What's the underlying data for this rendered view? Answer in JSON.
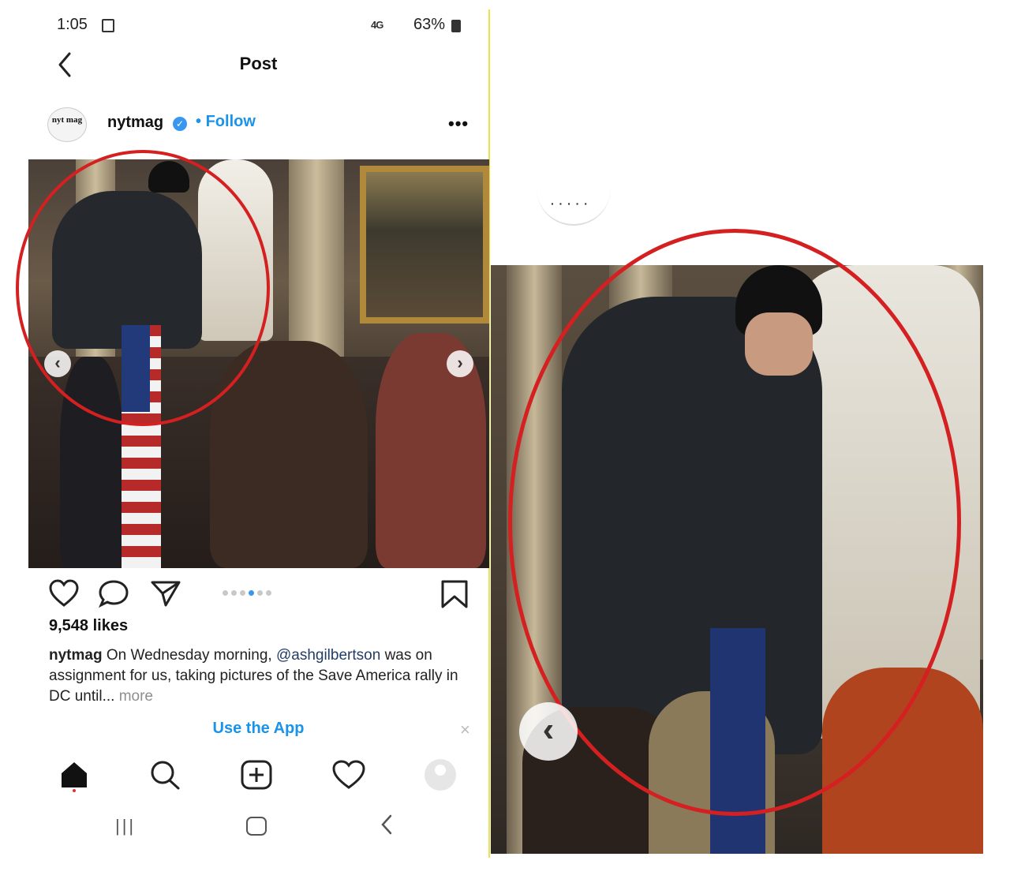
{
  "status_bar": {
    "time": "1:05",
    "network": "4G",
    "battery": "63%"
  },
  "header": {
    "title": "Post"
  },
  "post": {
    "username": "nytmag",
    "avatar_text": "nyt mag",
    "follow_label": "Follow",
    "follow_separator": "•",
    "more_label": "•••",
    "likes": "9,548 likes",
    "caption": {
      "user": "nytmag",
      "text_1": "On Wednesday morning,",
      "mention": "@ashgilbertson",
      "text_2": "was on assignment for us, taking pictures of the Save America rally in DC until...",
      "more": "more"
    },
    "carousel": {
      "count": 6,
      "active_index": 3
    }
  },
  "banner": {
    "use_app": "Use the App",
    "close": "×"
  },
  "bottom_nav": {
    "items": [
      "home-icon",
      "search-icon",
      "new-post-icon",
      "activity-icon",
      "profile-icon"
    ]
  },
  "system_nav": [
    "recents",
    "home",
    "back"
  ],
  "colors": {
    "link_blue": "#1a93e8",
    "verified_blue": "#3897f0",
    "annotation_red": "#d42020",
    "edge_yellow": "#e9e24a"
  },
  "zoom_panel": {
    "partial_avatar_text": "· · · · ·"
  }
}
